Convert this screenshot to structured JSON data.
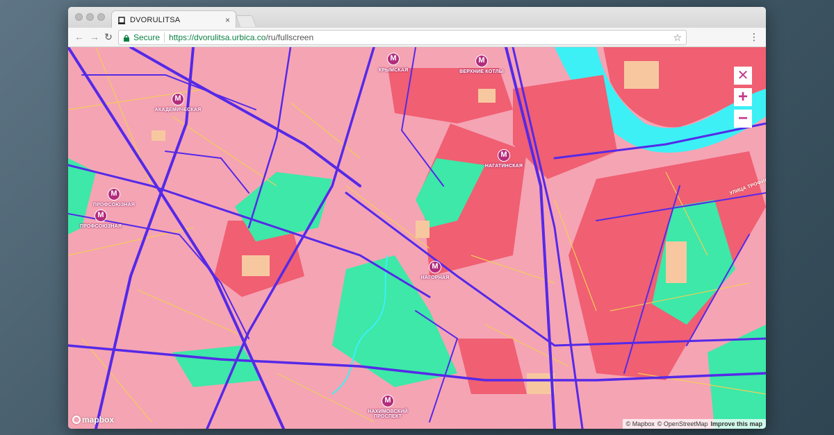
{
  "browser": {
    "tab_title": "DVORULITSA",
    "tab_close": "×",
    "secure_label": "Secure",
    "url_host": "https://dvorulitsa.urbica.co",
    "url_path": "/ru/fullscreen",
    "icons": [
      "favicon-icon",
      "close-icon",
      "back-icon",
      "forward-icon",
      "reload-icon",
      "lock-icon",
      "star-icon",
      "menu-icon"
    ]
  },
  "map": {
    "colors": {
      "residential": "#f5a4b4",
      "industrial": "#f05f72",
      "green": "#3de8a8",
      "water": "#3cf0f5",
      "building": "#f7c8a0",
      "road": "#5529e8",
      "minor_road": "#f3cd55",
      "metro": "#b42c7d"
    },
    "controls": [
      {
        "name": "close",
        "label": "✕"
      },
      {
        "name": "zoom-in",
        "label": "+"
      },
      {
        "name": "zoom-out",
        "label": "−"
      }
    ],
    "metro_stations": [
      {
        "name": "krymskaya",
        "label": "КРЫМСКАЯ",
        "icon": "М"
      },
      {
        "name": "verkhnie-kotly",
        "label": "ВЕРХНИЕ КОТЛЫ",
        "icon": "М"
      },
      {
        "name": "akademicheskaya",
        "label": "АКАДЕМИЧЕСКАЯ",
        "icon": "М"
      },
      {
        "name": "nagatinskaya",
        "label": "НАГАТИНСКАЯ",
        "icon": "М"
      },
      {
        "name": "profsoyuznaya",
        "label": "ПРОФСОЮЗНАЯ",
        "icon": "М"
      },
      {
        "name": "profsoyuznaya-2",
        "label": "ПРОФСОЮЗНАЯ",
        "icon": "М"
      },
      {
        "name": "nagornaya",
        "label": "НАГОРНАЯ",
        "icon": "М"
      },
      {
        "name": "nakhimovsky",
        "label": "НАХИМОВСКИЙ ПРОСПЕКТ",
        "icon": "М"
      }
    ],
    "street_label": "УЛИЦА ТРОФИМОВА",
    "logo": "mapbox",
    "attribution": {
      "mapbox": "© Mapbox",
      "osm": "© OpenStreetMap",
      "improve": "Improve this map"
    }
  }
}
